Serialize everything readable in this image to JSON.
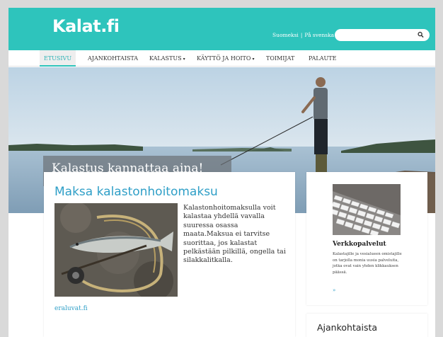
{
  "header": {
    "logo": "Kalat.fi",
    "lang_fi": "Suomeksi",
    "lang_sep": "|",
    "lang_sv": "På svenska",
    "search_placeholder": ""
  },
  "nav": {
    "items": [
      {
        "label": "ETUSIVU",
        "active": true
      },
      {
        "label": "AJANKOHTAISTA"
      },
      {
        "label": "KALASTUS",
        "caret": "▾"
      },
      {
        "label": "KÄYTTÖ JA HOITO",
        "caret": "▾"
      },
      {
        "label": "TOIMIJAT"
      },
      {
        "label": "PALAUTE"
      }
    ]
  },
  "hero": {
    "title": "Kalastus kannattaa aina!"
  },
  "main_card": {
    "title": "Maksa kalastonhoitomaksu",
    "text": "Kalastonhoitomaksulla voit kalastaa yhdellä vavalla suuressa osassa maata.Maksua ei tarvitse suorittaa, jos kalastat pelkästään pilkillä, ongella tai silakkalitkalla.",
    "link": "eraluvat.fi"
  },
  "side_card": {
    "title": "Verkkopalvelut",
    "text": "Kalastajille ja vesialueen omistajille on tarjolla monia uusia palveluita, jotka ovat vain yhden klikkauksen päässä.",
    "more": "»"
  },
  "news_card": {
    "title": "Ajankohtaista"
  },
  "colors": {
    "header": "#2ec4bc",
    "link": "#2f9fc7",
    "nav_active": "#2eb2b5"
  }
}
